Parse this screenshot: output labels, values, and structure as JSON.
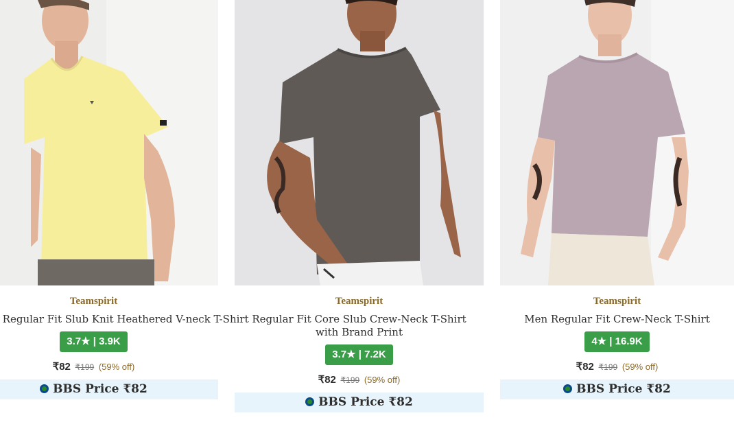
{
  "products": [
    {
      "brand": "Teamspirit",
      "name": "Men Regular Fit Slub Knit Heathered V-neck T-Shirt",
      "rating": "3.7★ | 3.9K",
      "sale_price": "₹82",
      "mrp": "₹199",
      "discount": "(59% off)",
      "bbs_label": "BBS Price ₹82",
      "tshirt_color": "#f7ee9c"
    },
    {
      "brand": "Teamspirit",
      "name": "Regular Fit Core Slub Crew-Neck T-Shirt with Brand Print",
      "rating": "3.7★ | 7.2K",
      "sale_price": "₹82",
      "mrp": "₹199",
      "discount": "(59% off)",
      "bbs_label": "BBS Price ₹82",
      "tshirt_color": "#5f5a56"
    },
    {
      "brand": "Teamspirit",
      "name": "Men Regular Fit Crew-Neck T-Shirt",
      "rating": "4★ | 16.9K",
      "sale_price": "₹82",
      "mrp": "₹199",
      "discount": "(59% off)",
      "bbs_label": "BBS Price ₹82",
      "tshirt_color": "#b9a6b1"
    }
  ],
  "colors": {
    "brand_text": "#8a6a2a",
    "rating_badge": "#3a9e48",
    "bbs_background": "#e7f4fb"
  }
}
